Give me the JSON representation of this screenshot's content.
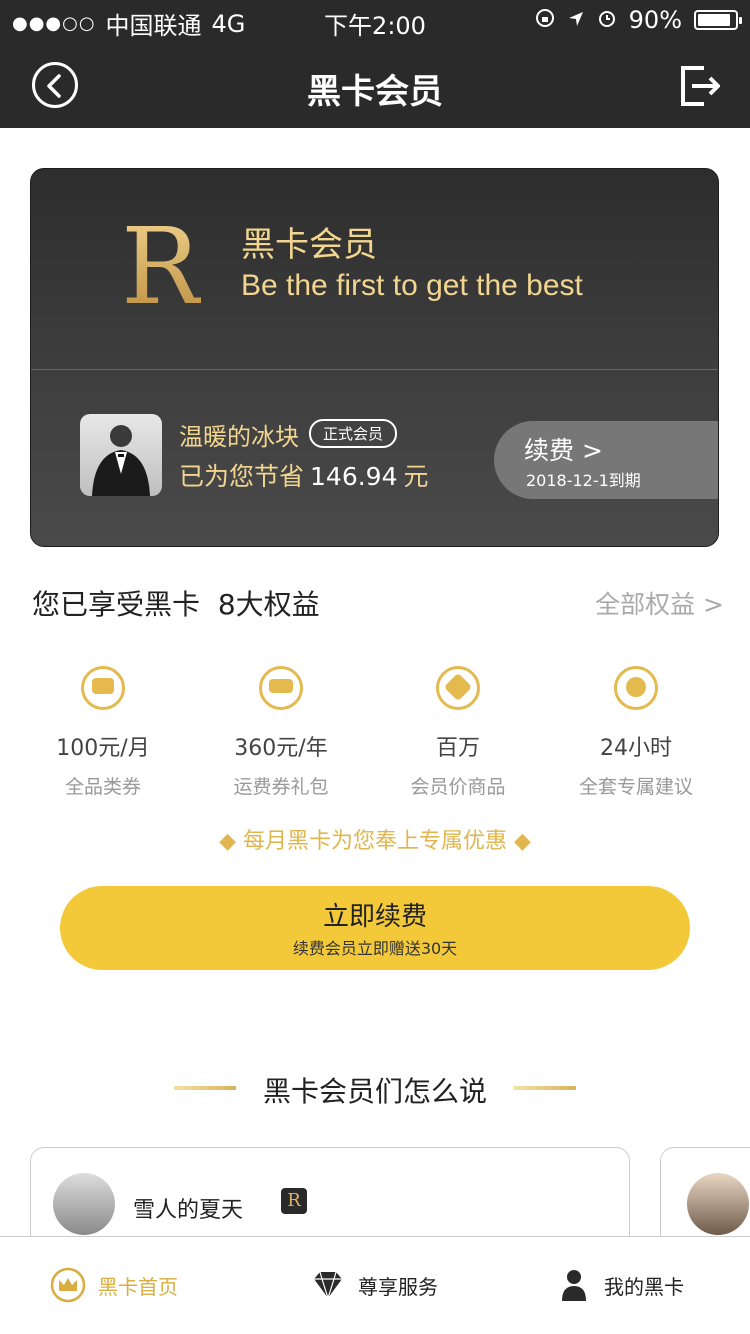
{
  "status_bar": {
    "signal": "●●●○○",
    "carrier": "中国联通",
    "network": "4G",
    "time": "下午2:00",
    "battery": "90%",
    "battery_level": 0.9
  },
  "nav": {
    "title": "黑卡会员"
  },
  "card": {
    "logo_letter": "R",
    "title": "黑卡会员",
    "slogan": "Be the first to get the best",
    "member_name": "温暖的冰块",
    "member_badge": "正式会员",
    "savings_prefix": "已为您节省",
    "savings_amount": "146.94",
    "savings_unit": "元",
    "renew_label": "续费 >",
    "expiry": "2018-12-1到期"
  },
  "benefits": {
    "title_prefix": "您已享受黑卡",
    "title_count": "8大权益",
    "all_link": "全部权益 >",
    "items": [
      {
        "value": "100元/月",
        "label": "全品类券",
        "icon": "coupon-icon"
      },
      {
        "value": "360元/年",
        "label": "运费券礼包",
        "icon": "truck-icon"
      },
      {
        "value": "百万",
        "label": "会员价商品",
        "icon": "tag-icon"
      },
      {
        "value": "24小时",
        "label": "全套专属建议",
        "icon": "headset-icon"
      }
    ]
  },
  "promo": "◆ 每月黑卡为您奉上专属优惠 ◆",
  "renew_button": {
    "label": "立即续费",
    "sub": "续费会员立即赠送30天"
  },
  "reviews": {
    "title": "黑卡会员们怎么说",
    "items": [
      {
        "name": "雪人的夏天",
        "badge": "R"
      }
    ]
  },
  "tabs": [
    {
      "label": "黑卡首页",
      "icon": "crown-icon",
      "active": true
    },
    {
      "label": "尊享服务",
      "icon": "diamond-icon",
      "active": false
    },
    {
      "label": "我的黑卡",
      "icon": "user-icon",
      "active": false
    }
  ],
  "colors": {
    "gold": "#d9ad3f",
    "button_yellow": "#f3c93a",
    "dark": "#2a2a2a"
  }
}
